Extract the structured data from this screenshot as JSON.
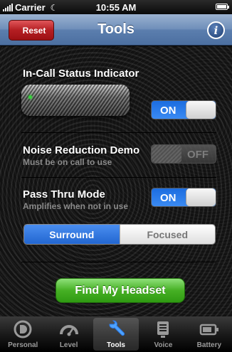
{
  "status_bar": {
    "carrier": "Carrier",
    "time": "10:55 AM"
  },
  "nav": {
    "title": "Tools",
    "reset_label": "Reset",
    "info_label": "i"
  },
  "sections": {
    "in_call": {
      "title": "In-Call Status Indicator",
      "toggle": "ON"
    },
    "noise": {
      "title": "Noise Reduction Demo",
      "subtitle": "Must be on call to use",
      "toggle": "OFF"
    },
    "pass_thru": {
      "title": "Pass Thru Mode",
      "subtitle": "Amplifies when not in use",
      "toggle": "ON"
    },
    "mode": {
      "options": [
        "Surround",
        "Focused"
      ],
      "selected": "Surround"
    }
  },
  "find_button": "Find My Headset",
  "tabs": [
    {
      "label": "Personal",
      "icon": "personal-icon"
    },
    {
      "label": "Level",
      "icon": "gauge-icon"
    },
    {
      "label": "Tools",
      "icon": "wrench-icon"
    },
    {
      "label": "Voice",
      "icon": "document-icon"
    },
    {
      "label": "Battery",
      "icon": "battery-icon"
    }
  ],
  "active_tab": "Tools",
  "colors": {
    "accent_blue": "#2a78e6",
    "nav_blue": "#6f8fba",
    "reset_red": "#b41e22",
    "find_green": "#46b024"
  }
}
